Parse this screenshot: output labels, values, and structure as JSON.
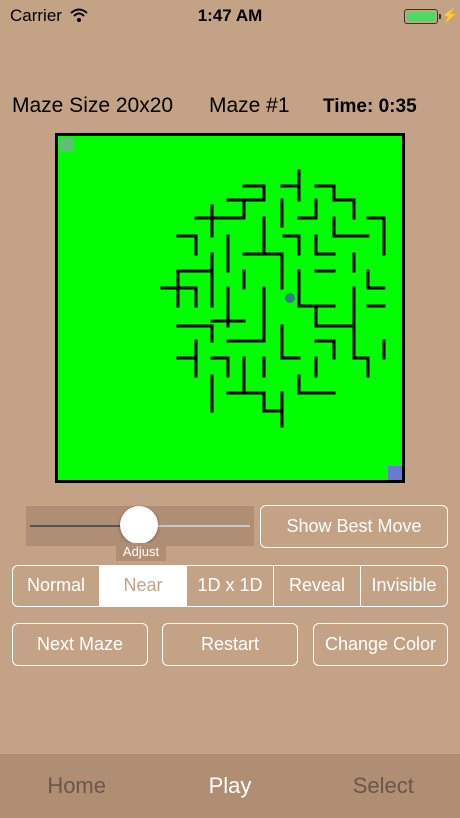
{
  "status": {
    "carrier": "Carrier",
    "time": "1:47 AM"
  },
  "header": {
    "maze_size": "Maze Size 20x20",
    "maze_number": "Maze #1",
    "time": "Time: 0:35"
  },
  "maze": {
    "background_color": "#00ff00",
    "start_color": "#5fbf74",
    "end_color": "#6a79d6",
    "player_color": "#2f7f84"
  },
  "slider": {
    "caption": "Adjust"
  },
  "buttons": {
    "show_best_move": "Show Best Move",
    "next_maze": "Next Maze",
    "restart": "Restart",
    "change_color": "Change Color"
  },
  "modes": {
    "options": [
      "Normal",
      "Near",
      "1D x 1D",
      "Reveal",
      "Invisible"
    ],
    "selected": "Near"
  },
  "tabs": {
    "items": [
      "Home",
      "Play",
      "Select"
    ],
    "active": "Play"
  },
  "colors": {
    "background": "#c4a285",
    "bar": "#b08e73",
    "accent": "#ffffff"
  }
}
